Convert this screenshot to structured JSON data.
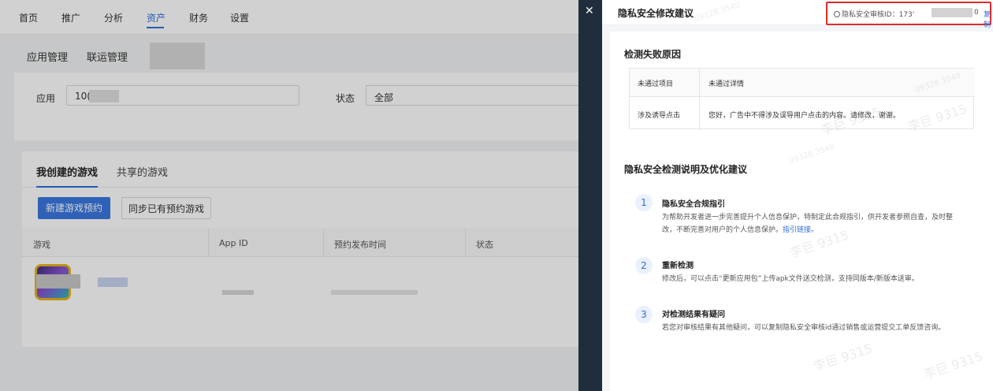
{
  "topnav": {
    "items": [
      "首页",
      "推广",
      "分析",
      "资产",
      "财务",
      "设置"
    ],
    "active_index": 3
  },
  "subnav": {
    "items": [
      "应用管理",
      "联运管理"
    ]
  },
  "filters": {
    "app_label": "应用",
    "app_value": "10(",
    "status_label": "状态",
    "status_value": "全部"
  },
  "games": {
    "tabs": [
      "我创建的游戏",
      "共享的游戏"
    ],
    "new_button": "新建游戏预约",
    "sync_button": "同步已有预约游戏",
    "columns": [
      "游戏",
      "App ID",
      "预约发布时间",
      "状态"
    ]
  },
  "drawer": {
    "close_symbol": "✕",
    "title": "隐私安全修改建议",
    "audit_label": "隐私安全审核ID：173'",
    "audit_tail": "0",
    "copy_label": "复制",
    "fail_section_title": "检测失败原因",
    "fail_table": {
      "headers": [
        "未通过项目",
        "未通过详情"
      ],
      "rows": [
        [
          "涉及诱导点击",
          "您好，广告中不得涉及误导用户点击的内容。请修改，谢谢。"
        ]
      ]
    },
    "guide_section_title": "隐私安全检测说明及优化建议",
    "steps": [
      {
        "num": "1",
        "title": "隐私安全合规指引",
        "desc_line1": "为帮助开发者进一步完善提升个人信息保护，特制定此合规指引，供开发者参照自查，及时整",
        "desc_line2": "改，不断完善对用户的个人信息保护。",
        "link": "指引链接。"
      },
      {
        "num": "2",
        "title": "重新检测",
        "desc_line1": "修改后，可以点击“更新应用包”上传apk文件送交检测，支持同版本/新版本送审。"
      },
      {
        "num": "3",
        "title": "对检测结果有疑问",
        "desc_line1": "若您对审核结果有其他疑问，可以复制隐私安全审核id通过销售或运营提交工单反馈咨询。"
      }
    ]
  },
  "watermark": {
    "name": "李巨 9315",
    "code": "09328 3540"
  },
  "colors": {
    "accent": "#2f6fdc",
    "highlight_border": "#e02b2b",
    "close_bar": "#1f2d3d"
  }
}
